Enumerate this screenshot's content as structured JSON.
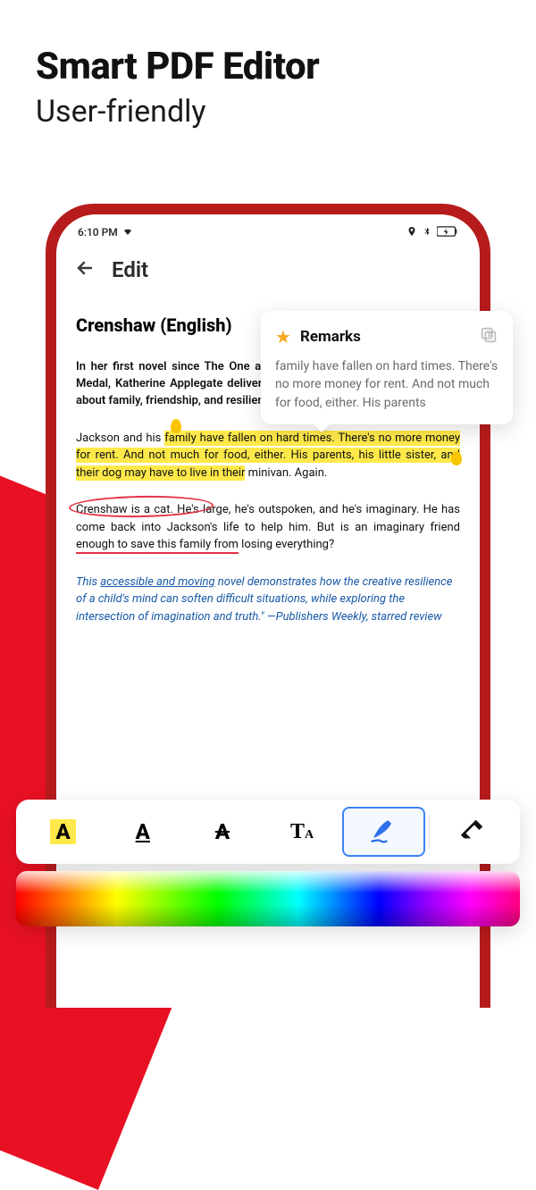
{
  "promo": {
    "title": "Smart PDF Editor",
    "subtitle": "User-friendly"
  },
  "status": {
    "time": "6:10 PM"
  },
  "header": {
    "title": "Edit"
  },
  "doc": {
    "title": "Crenshaw (English)",
    "p1": "In her first novel since The One and Only Ivan, winner of the Newbery Medal, Katherine Applegate delivers an unforgettable and magical story about family, friendship, and resilience.",
    "p2_pre": "Jackson and his ",
    "p2_hl": "family have fallen on hard times. There's no more money for rent. And not much for food, either. His parents, his little sister, and their dog may have to live in their",
    "p2_post": " minivan. Again.",
    "p3_a": "Crenshaw is a cat. He",
    "p3_b": "'s large, he's outspoken, and he's imaginary. He has come back into Jackson's life to help him. But is an imaginary friend ",
    "p3_c": "enough to save this family from",
    "p3_d": " losing everything?",
    "p4_a": "This ",
    "p4_b": "accessible and moving",
    "p4_c": " novel demonstrates how the creative resilience of a child's mind can soften difficult situations, while exploring the intersection of imagination and truth.\" —Publishers Weekly, starred review"
  },
  "remarks": {
    "title": "Remarks",
    "body": "family have fallen on hard times. There's no more money for rent. And not much for food, either. His parents"
  },
  "tools": {
    "highlight": "A",
    "underline": "A",
    "strike": "A",
    "text_big": "T",
    "text_small": "A"
  }
}
